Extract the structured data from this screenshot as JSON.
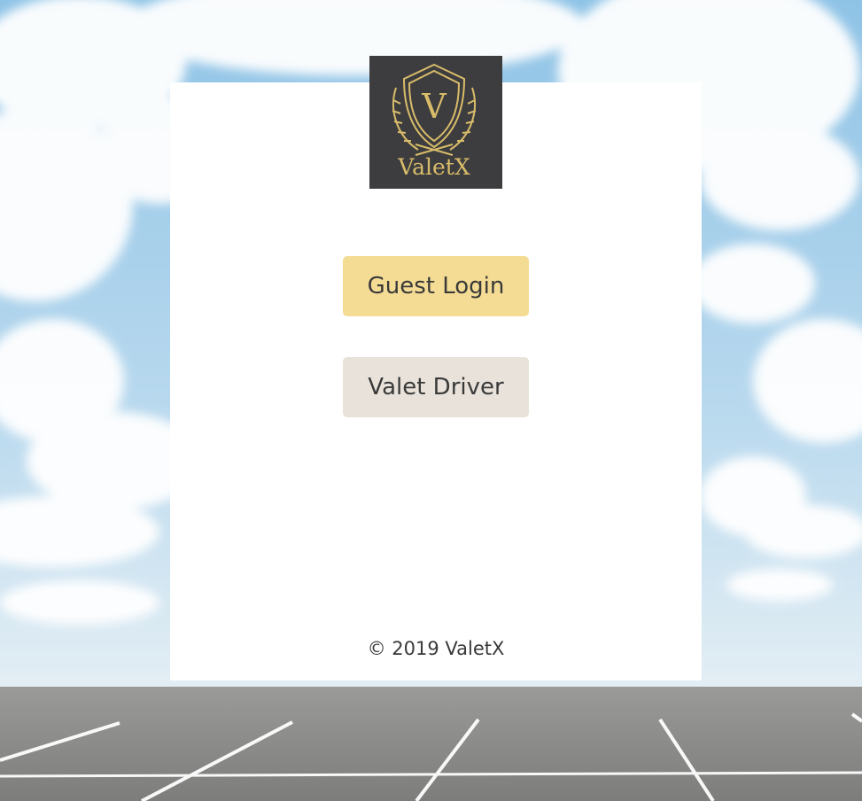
{
  "brand": {
    "logo_letter": "V",
    "logo_wordmark": "ValetX",
    "logo_bg_color": "#3d3d3f",
    "logo_gold_color": "#d9bc6a"
  },
  "actions": {
    "guest_login_label": "Guest Login",
    "valet_driver_label": "Valet Driver"
  },
  "footer": {
    "copyright": "© 2019 ValetX"
  },
  "colors": {
    "guest_button": "#f5dc94",
    "valet_button": "#e8e2da",
    "card": "#ffffff",
    "text": "#3a3a3a"
  }
}
